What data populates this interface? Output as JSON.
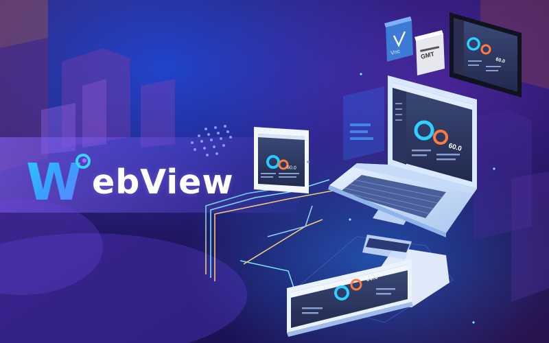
{
  "brand": {
    "logo_letter": "W",
    "wordmark": "ebView"
  },
  "devices": {
    "tablet_value": "60.0",
    "laptop_value": "60.0",
    "phone_value": "60.0"
  },
  "app_icons": [
    {
      "label": "Vnc",
      "icon": "vnc-icon"
    },
    {
      "label": "GMT",
      "icon": "gmt-icon"
    }
  ],
  "monitor": {
    "value": "60.0"
  },
  "colors": {
    "background_dark": "#1e1453",
    "accent_cyan": "#25d3ff",
    "accent_purple": "#7b3cff",
    "accent_orange": "#ff7a3d",
    "accent_gold": "#ffc24a"
  }
}
